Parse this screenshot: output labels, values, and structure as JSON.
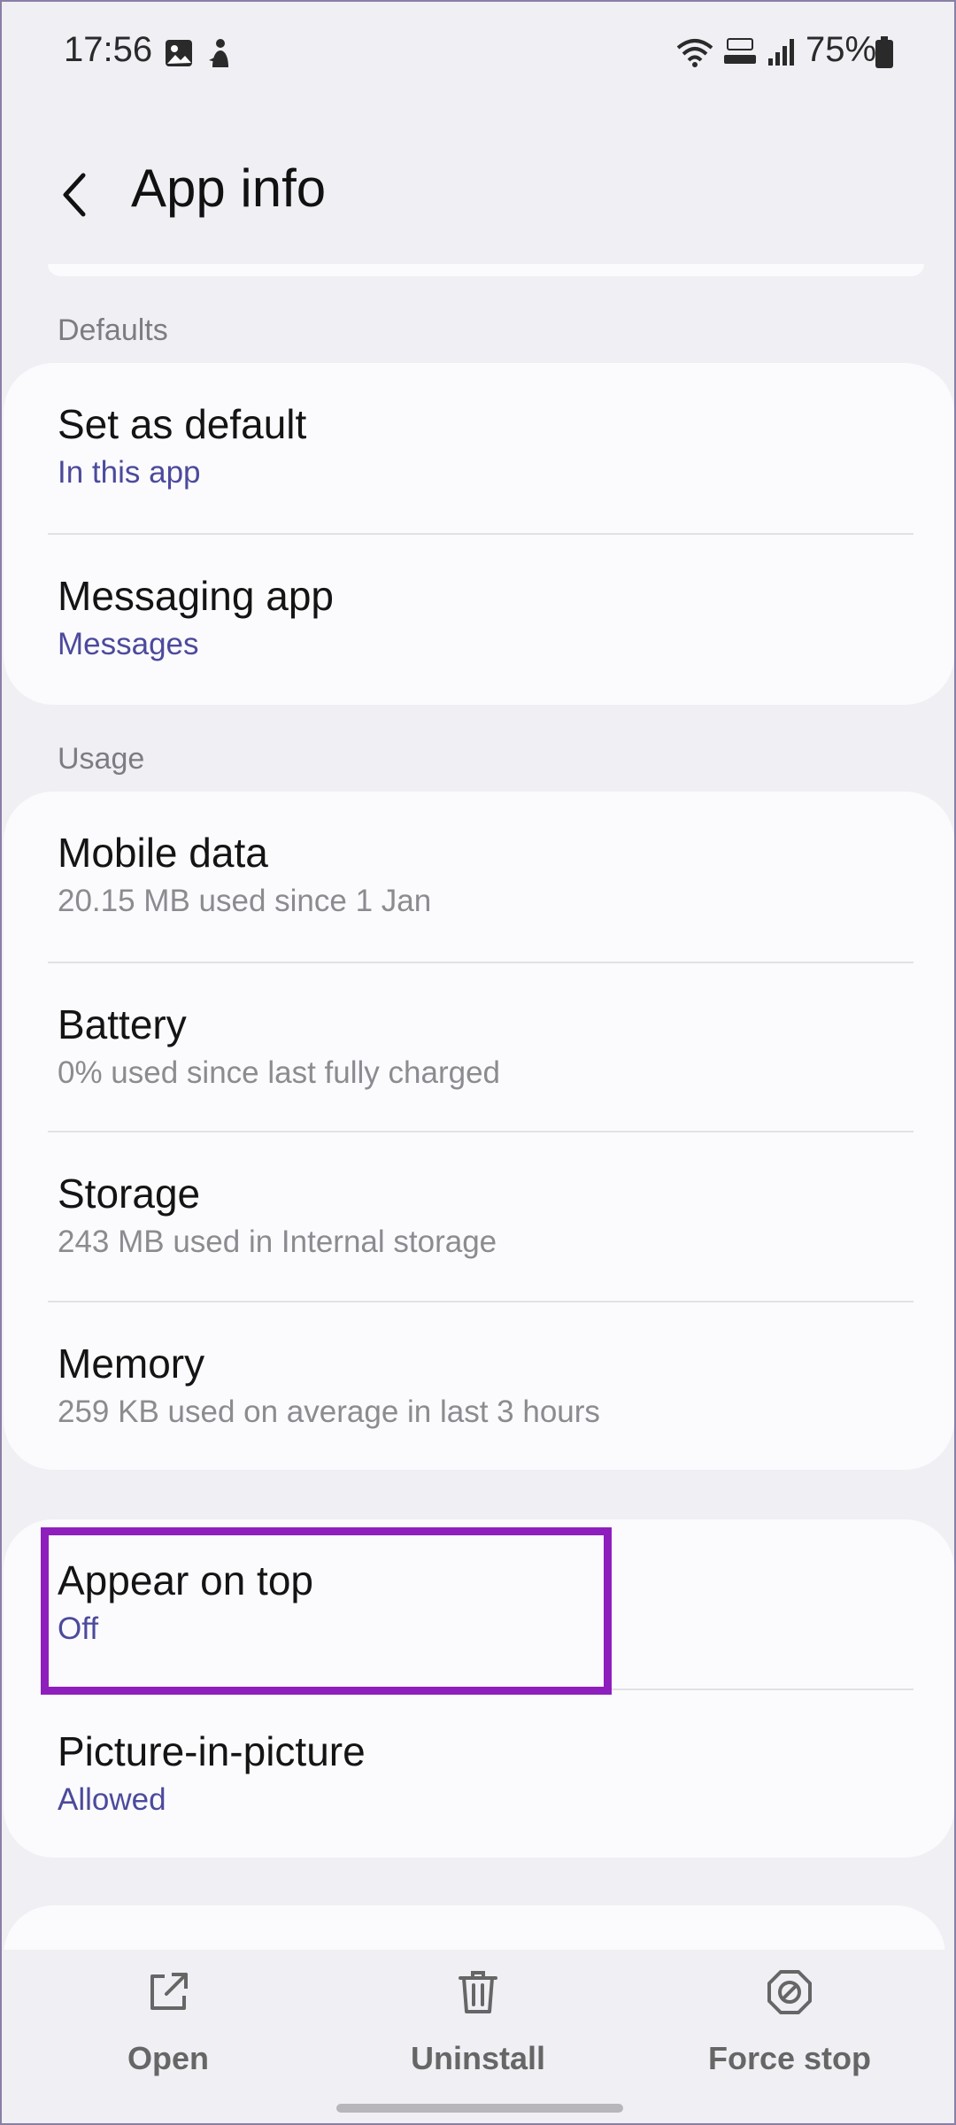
{
  "status_bar": {
    "time": "17:56",
    "battery_percent": "75%",
    "icons": [
      "gallery-icon",
      "notification-icon",
      "wifi-icon",
      "volte-lte-icon",
      "signal-icon",
      "battery-icon"
    ]
  },
  "header": {
    "title": "App info",
    "back_icon": "chevron-left-icon"
  },
  "sections": {
    "defaults": {
      "label": "Defaults",
      "items": [
        {
          "title": "Set as default",
          "subtitle": "In this app"
        },
        {
          "title": "Messaging app",
          "subtitle": "Messages"
        }
      ]
    },
    "usage": {
      "label": "Usage",
      "items": [
        {
          "title": "Mobile data",
          "subtitle": "20.15 MB used since 1 Jan"
        },
        {
          "title": "Battery",
          "subtitle": "0% used since last fully charged"
        },
        {
          "title": "Storage",
          "subtitle": "243 MB used in Internal storage"
        },
        {
          "title": "Memory",
          "subtitle": "259 KB used on average in last 3 hours"
        }
      ]
    },
    "permissions": {
      "items": [
        {
          "title": "Appear on top",
          "subtitle": "Off"
        },
        {
          "title": "Picture-in-picture",
          "subtitle": "Allowed"
        }
      ]
    }
  },
  "bottom_actions": [
    {
      "label": "Open",
      "icon": "open-external-icon"
    },
    {
      "label": "Uninstall",
      "icon": "trash-icon"
    },
    {
      "label": "Force stop",
      "icon": "block-icon"
    }
  ],
  "colors": {
    "background": "#f0eff4",
    "card": "#fbfbfd",
    "accent_subtitle": "#4c4a9c",
    "highlight": "#8e1fbd"
  }
}
